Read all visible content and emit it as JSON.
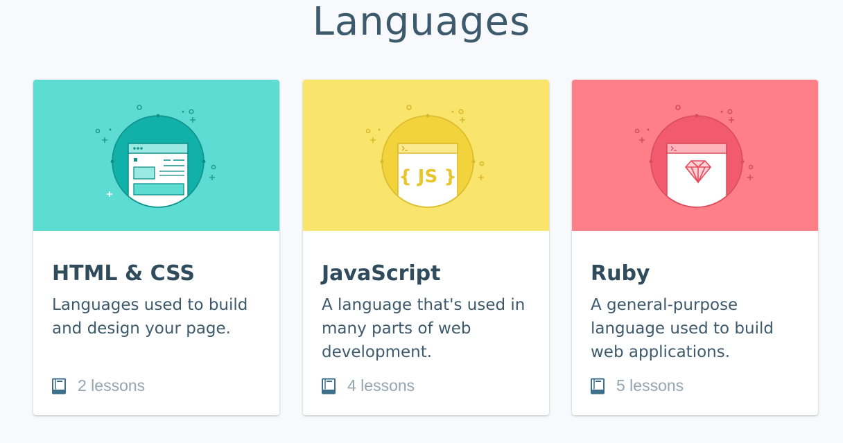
{
  "page": {
    "title": "Languages"
  },
  "cards": [
    {
      "title": "HTML & CSS",
      "description": "Languages used to build and design your page.",
      "lessons": "2 lessons",
      "icon": "browser-window-icon",
      "banner_color": "#5ddcd3"
    },
    {
      "title": "JavaScript",
      "description": "A language that's used in many parts of web development.",
      "lessons": "4 lessons",
      "icon": "js-braces-icon",
      "banner_color": "#f9e46c"
    },
    {
      "title": "Ruby",
      "description": "A general-purpose language used to build web applications.",
      "lessons": "5 lessons",
      "icon": "ruby-gem-icon",
      "banner_color": "#ff7f89"
    }
  ]
}
